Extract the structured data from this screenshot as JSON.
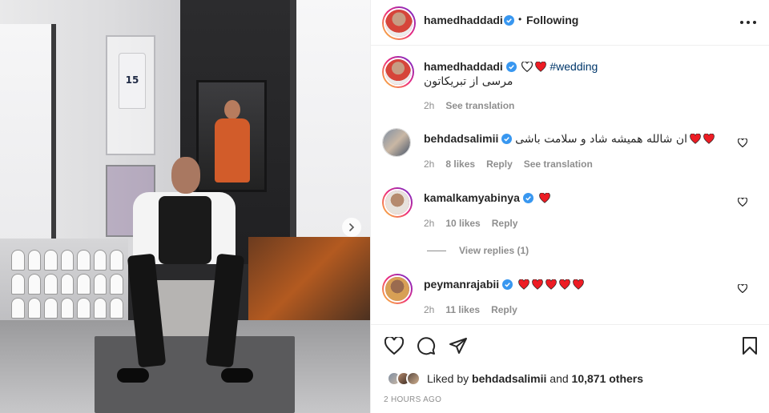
{
  "post": {
    "author": "hamedhaddadi",
    "separator": "•",
    "follow_status": "Following",
    "photo_alt": "Man in a tuxedo vest seated in a room with framed basketball jerseys"
  },
  "caption": {
    "username": "hamedhaddadi",
    "hashtag": "#wedding",
    "text": "مرسی از تبریکاتون",
    "age": "2h",
    "see_translation": "See translation"
  },
  "comments": [
    {
      "username": "behdadsalimii",
      "text": "ان شالله همیشه شاد و سلامت باشی",
      "hearts_count": 2,
      "age": "2h",
      "likes": "8 likes",
      "reply": "Reply",
      "see_translation": "See translation"
    },
    {
      "username": "kamalkamyabinya",
      "text": "",
      "hearts_count": 1,
      "age": "2h",
      "likes": "10 likes",
      "reply": "Reply",
      "view_replies": "View replies (1)"
    },
    {
      "username": "peymanrajabii",
      "text": "",
      "hearts_count": 5,
      "age": "2h",
      "likes": "11 likes",
      "reply": "Reply"
    }
  ],
  "likes": {
    "prefix": "Liked by",
    "first_user": "behdadsalimii",
    "and": "and",
    "others": "10,871 others"
  },
  "timestamp": "2 HOURS AGO",
  "colors": {
    "verified_blue": "#3897f0",
    "heart_red": "#ed1c24",
    "meta_gray": "#8e8e8e",
    "text": "#262626",
    "hashtag": "#00376b"
  },
  "icons": [
    "verified-badge-icon",
    "more-options-icon",
    "heart-outline-icon",
    "heart-red-icon",
    "comment-icon",
    "share-icon",
    "bookmark-icon",
    "next-arrow-icon"
  ]
}
